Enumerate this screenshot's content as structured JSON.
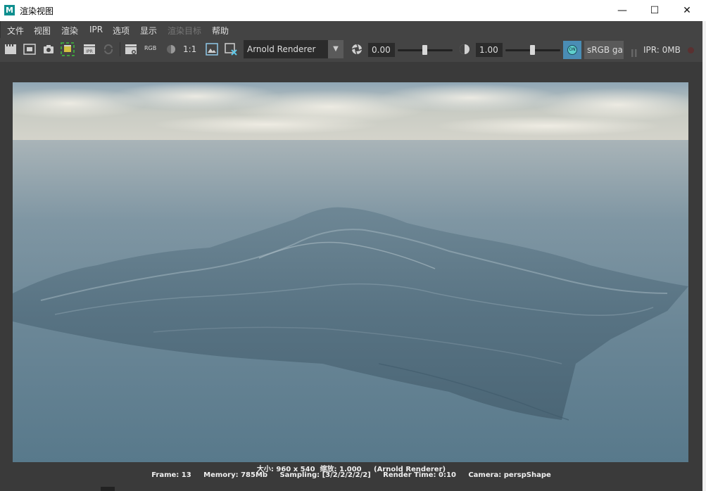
{
  "window": {
    "title": "渲染视图",
    "logo_letter": "M",
    "controls": {
      "minimize": "—",
      "maximize": "☐",
      "close": "✕"
    }
  },
  "menu": [
    {
      "label": "文件",
      "enabled": true
    },
    {
      "label": "视图",
      "enabled": true
    },
    {
      "label": "渲染",
      "enabled": true
    },
    {
      "label": "IPR",
      "enabled": true
    },
    {
      "label": "选项",
      "enabled": true
    },
    {
      "label": "显示",
      "enabled": true
    },
    {
      "label": "渲染目标",
      "enabled": false
    },
    {
      "label": "帮助",
      "enabled": true
    }
  ],
  "toolbar": {
    "icons": [
      "redo-render-icon",
      "render-region-icon",
      "snapshot-icon",
      "ipr-region-icon",
      "ipr-render-icon",
      "refresh-icon",
      "keep-image-icon",
      "rgb-channels-icon",
      "exposure-toggle-icon",
      "one-to-one-icon",
      "display-image-icon",
      "remove-image-icon"
    ],
    "rgb_label": "RGB",
    "ratio_label": "1:1",
    "renderer": "Arnold Renderer",
    "exposure_value": "0.00",
    "gamma_value": "1.00",
    "colormgmt_label": "ON",
    "colorspace": "sRGB gamma",
    "ipr_memory": "IPR: 0MB"
  },
  "status": {
    "line1": "大小: 960 x 540  缩放: 1.000     (Arnold Renderer)",
    "line2": "Frame: 13     Memory: 785Mb     Sampling: [3/2/2/2/2/2]     Render Time: 0:10     Camera: perspShape"
  },
  "colors": {
    "ui_bg": "#444444",
    "accent_teal": "#0f8f8f",
    "colormgmt_on": "#4a8db5"
  }
}
